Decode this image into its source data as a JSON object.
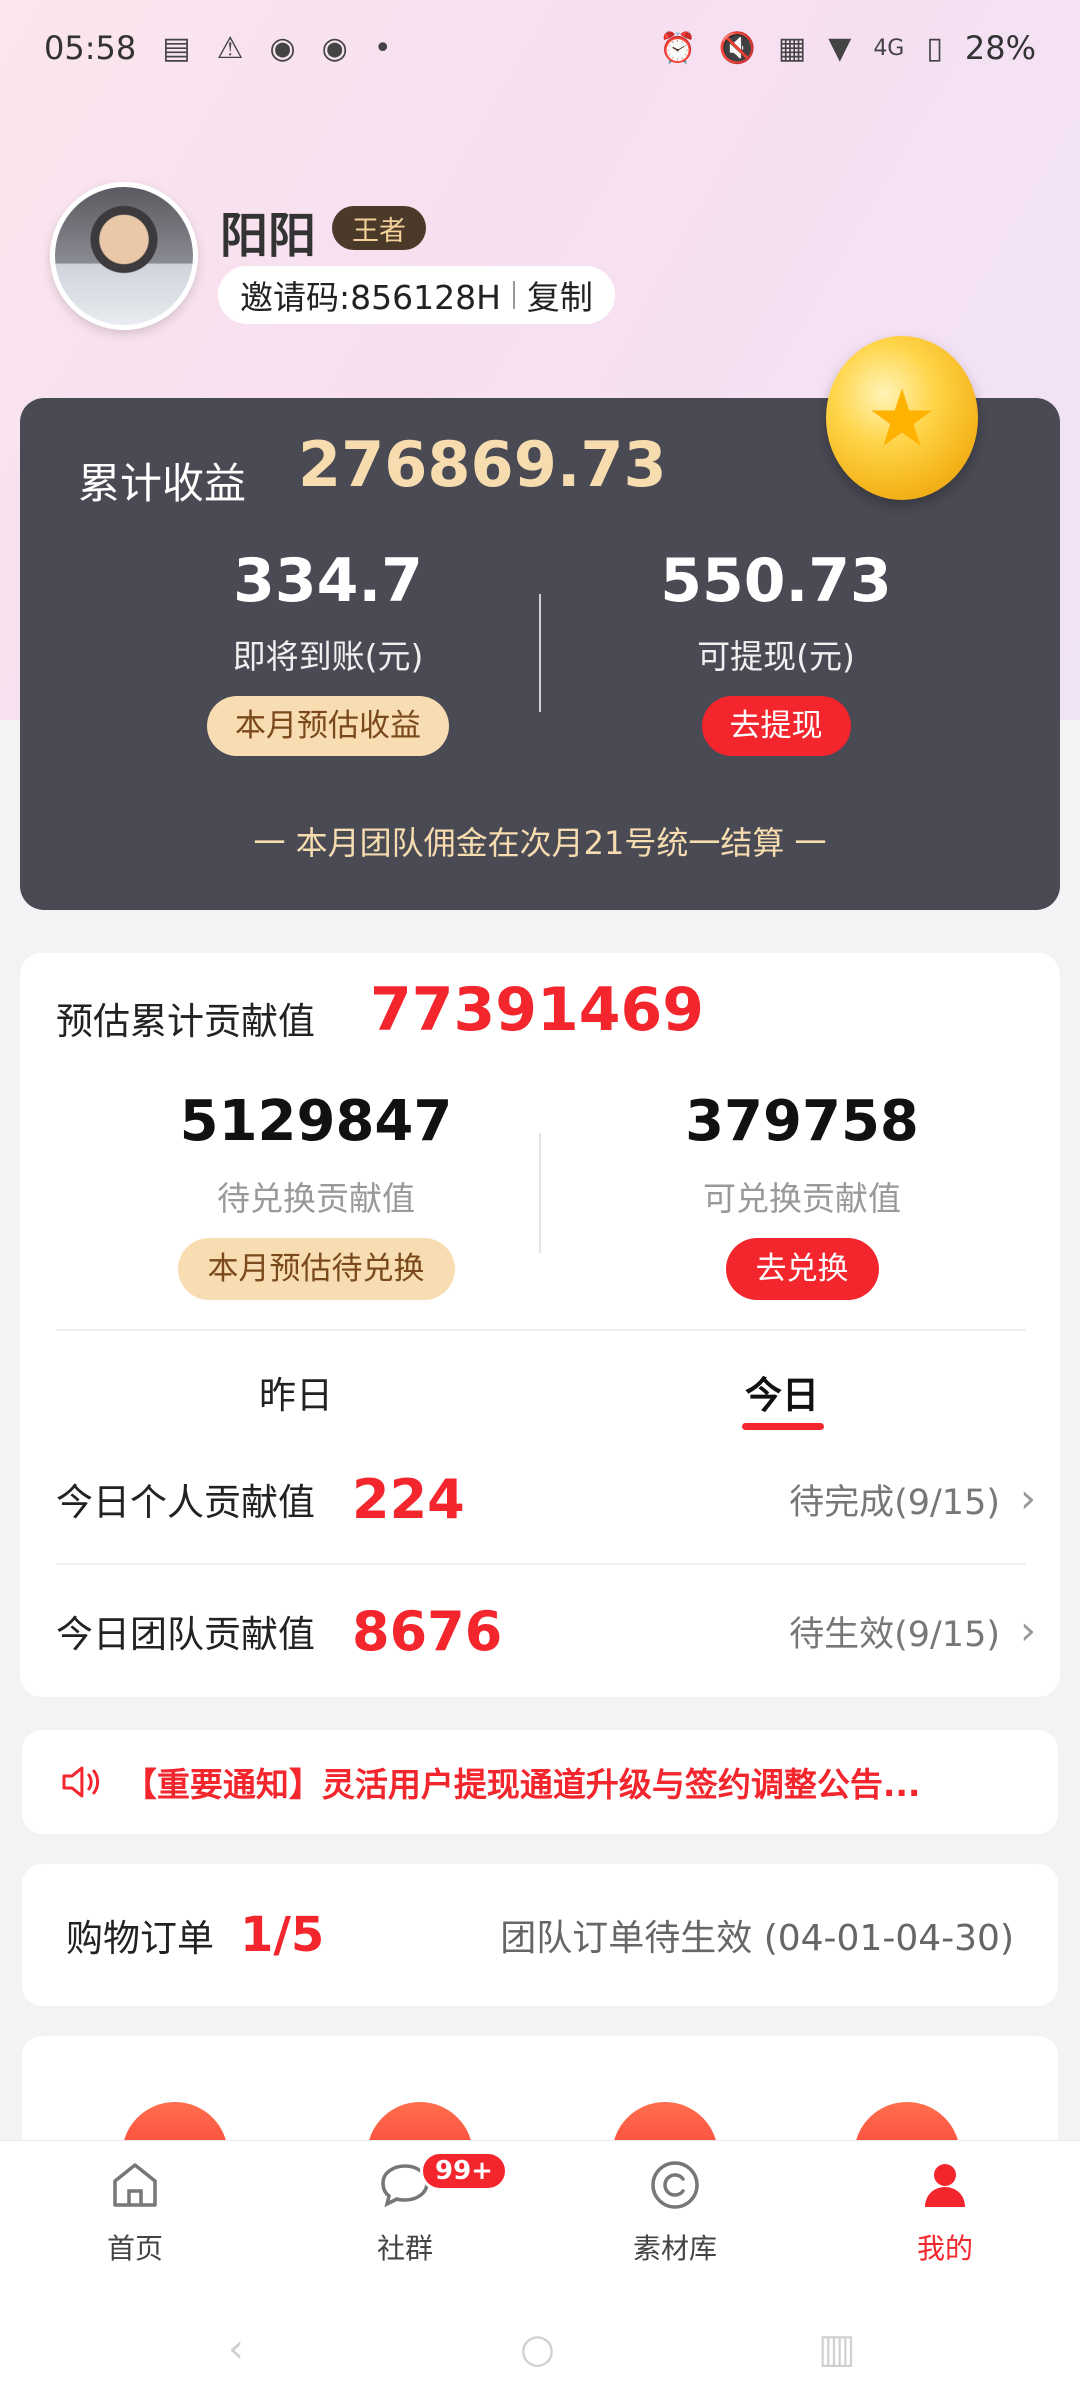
{
  "status_bar": {
    "time": "05:58",
    "battery": "28%",
    "network": "4G"
  },
  "profile": {
    "name": "阳阳",
    "rank": "王者",
    "invite_text": "邀请码:856128H",
    "copy_label": "复制"
  },
  "earnings": {
    "total_label": "累计收益",
    "total_value": "276869.73",
    "pending_value": "334.7",
    "pending_label": "即将到账(元)",
    "pending_button": "本月预估收益",
    "withdrawable_value": "550.73",
    "withdrawable_label": "可提现(元)",
    "withdraw_button": "去提现",
    "settlement_note": "一  本月团队佣金在次月21号统一结算  一"
  },
  "contribution": {
    "total_label": "预估累计贡献值",
    "total_value": "77391469",
    "pending_value": "5129847",
    "pending_label": "待兑换贡献值",
    "pending_button": "本月预估待兑换",
    "exchangeable_value": "379758",
    "exchangeable_label": "可兑换贡献值",
    "exchange_button": "去兑换",
    "tabs": [
      "昨日",
      "今日"
    ],
    "active_tab": "今日",
    "personal_label": "今日个人贡献值",
    "personal_value": "224",
    "personal_status": "待完成(9/15)",
    "team_label": "今日团队贡献值",
    "team_value": "8676",
    "team_status": "待生效(9/15)"
  },
  "notice": {
    "text": "【重要通知】灵活用户提现通道升级与签约调整公告..."
  },
  "orders": {
    "label": "购物订单",
    "count": "1/5",
    "status": "团队订单待生效 (04-01-04-30)"
  },
  "bottom_nav": {
    "items": [
      "首页",
      "社群",
      "素材库",
      "我的"
    ],
    "active": "我的",
    "badge": "99+"
  },
  "colors": {
    "accent_red": "#f3252d",
    "card_dark": "#4a4a55",
    "gold_text": "#f6dcae"
  }
}
